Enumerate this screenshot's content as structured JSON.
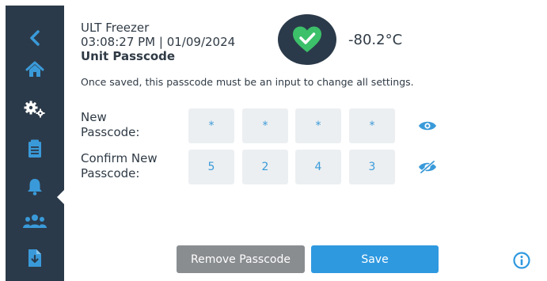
{
  "sidebar": {
    "items": [
      {
        "icon": "back-arrow-icon",
        "active": false
      },
      {
        "icon": "home-icon",
        "active": false
      },
      {
        "icon": "settings-gears-icon",
        "active": true
      },
      {
        "icon": "clipboard-log-icon",
        "active": false
      },
      {
        "icon": "bell-icon",
        "active": false
      },
      {
        "icon": "users-icon",
        "active": false
      },
      {
        "icon": "file-download-icon",
        "active": false
      }
    ]
  },
  "header": {
    "device_name": "ULT Freezer",
    "clock": "03:08:27 PM | 01/09/2024",
    "page_title": "Unit Passcode",
    "status_icon": "checkmark-heart-icon",
    "temperature": "-80.2°C"
  },
  "main": {
    "note": "Once saved, this passcode must be an input to change all settings.",
    "new_passcode": {
      "label": "New\nPasscode:",
      "digits": [
        "*",
        "*",
        "*",
        "*"
      ],
      "visibility_icon": "eye-icon"
    },
    "confirm_passcode": {
      "label": "Confirm New\nPasscode:",
      "digits": [
        "5",
        "2",
        "4",
        "3"
      ],
      "visibility_icon": "eye-slash-icon"
    }
  },
  "footer": {
    "remove_label": "Remove Passcode",
    "save_label": "Save",
    "info_icon": "info-icon"
  },
  "colors": {
    "sidebar_bg": "#2b3a4a",
    "accent_blue": "#2f99e0",
    "icon_blue": "#3a9ad9",
    "status_green": "#3cc06a",
    "remove_gray": "#8a8d90",
    "digit_box_bg": "#eceff1"
  }
}
